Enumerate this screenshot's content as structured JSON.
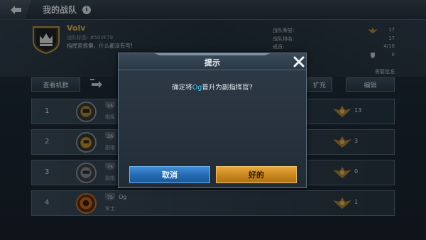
{
  "topbar": {
    "title": "我的战队",
    "info_icon": "i"
  },
  "team": {
    "name": "Volv",
    "tag": "战队标签: #50VF79",
    "motto": "指挥官很懒，什么都没有写!"
  },
  "stats": [
    {
      "label": "战队荣誉:",
      "value": "17"
    },
    {
      "label": "战队排名:",
      "value": "17"
    },
    {
      "label": "成员:",
      "value": "4/10"
    },
    {
      "label": "",
      "value": "0"
    }
  ],
  "need_approval": "需要批准",
  "buttons": {
    "view_mechs": "查看机群",
    "expand": "扩充",
    "edit": "编辑"
  },
  "members": [
    {
      "rank": "1",
      "level": "15",
      "name": "",
      "role": "指挥",
      "count": "13"
    },
    {
      "rank": "2",
      "level": "26",
      "name": "",
      "role": "副指",
      "count": "3"
    },
    {
      "rank": "3",
      "level": "75",
      "name": "",
      "role": "副指",
      "count": "0"
    },
    {
      "rank": "4",
      "level": "75",
      "name": "Og",
      "role": "军士",
      "count": "1"
    }
  ],
  "dialog": {
    "title": "提示",
    "message_pre": "确定将",
    "message_name": "Og",
    "message_post": "晋升为副指挥官?",
    "cancel_label": "取消",
    "ok_label": "好的"
  },
  "colors": {
    "highlight": "#4ec3f0",
    "cancel": "#2369b0",
    "ok": "#c98620",
    "team_name": "#e8bf4a"
  }
}
